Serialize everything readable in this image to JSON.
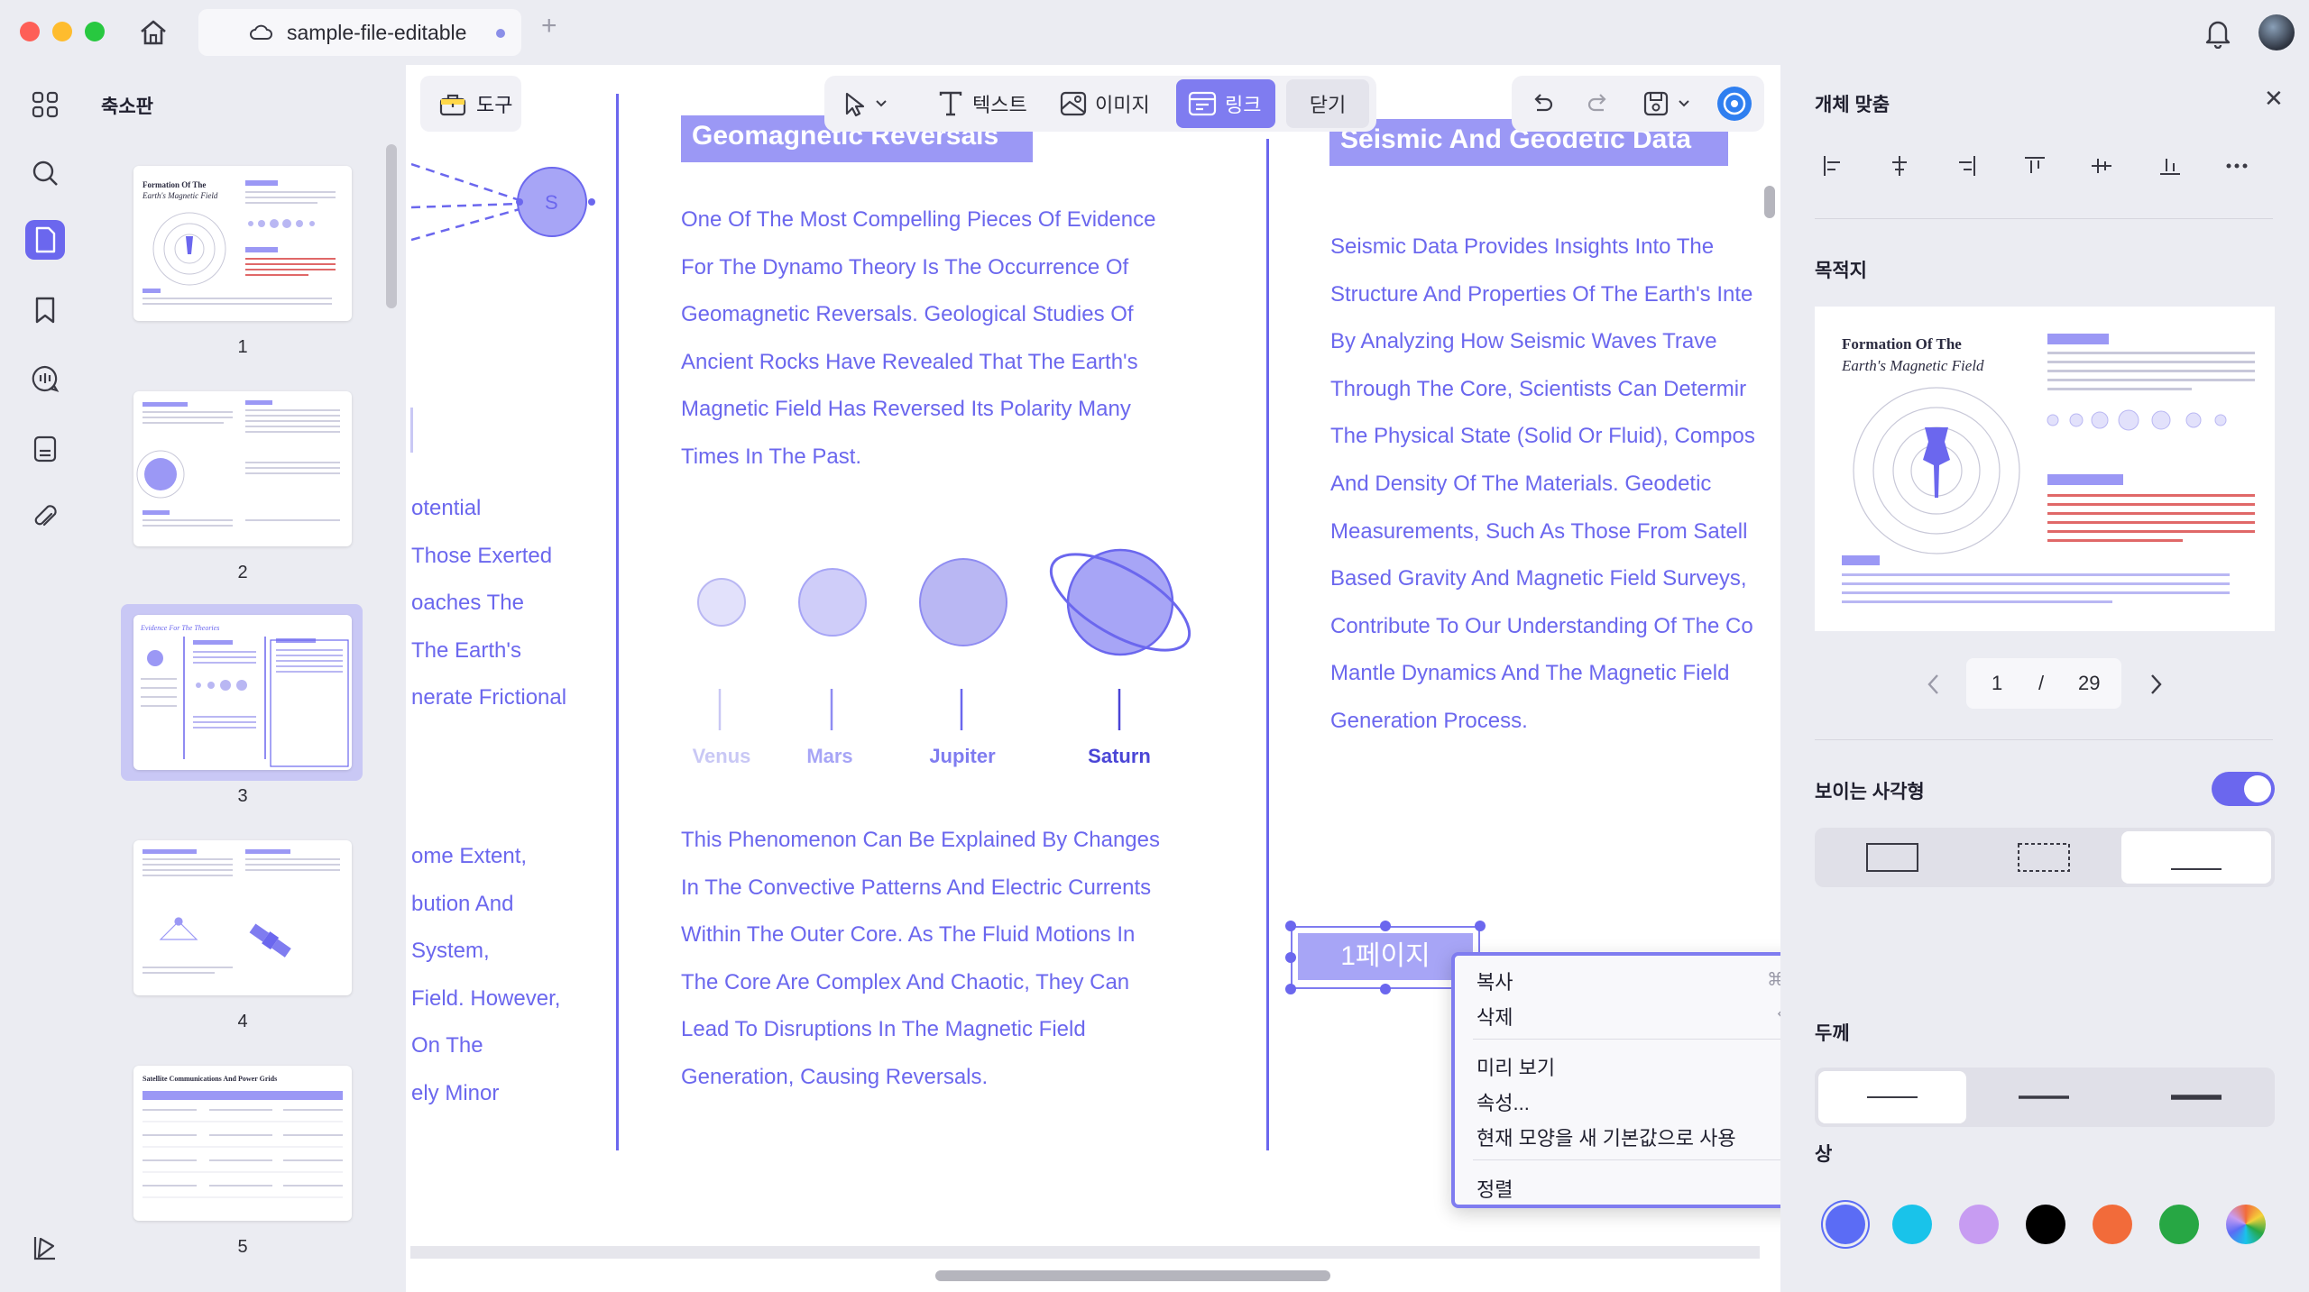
{
  "window": {
    "tab_title": "sample-file-editable",
    "tab_add": "+"
  },
  "thumbnails": {
    "title": "축소판",
    "pages": [
      {
        "num": "1",
        "heading": "Formation Of The",
        "subheading": "Earth's Magnetic Field"
      },
      {
        "num": "2"
      },
      {
        "num": "3",
        "heading": "Evidence For The Theories"
      },
      {
        "num": "4"
      },
      {
        "num": "5",
        "heading": "Satellite Communications And Power Grids"
      }
    ]
  },
  "toolbar": {
    "tools_label": "도구",
    "text_label": "텍스트",
    "image_label": "이미지",
    "link_label": "링크",
    "close_label": "닫기"
  },
  "document": {
    "left_fragments": [
      "otential",
      "Those Exerted",
      "oaches The",
      "The Earth's",
      "nerate Frictional",
      "ome Extent,",
      "bution And",
      "System,",
      "Field. However,",
      "On The",
      "ely Minor"
    ],
    "geomagnetic_heading": "Geomagnetic Reversals",
    "geomagnetic_paragraph": [
      "One Of The Most Compelling Pieces Of Evidence",
      "For The Dynamo Theory Is The Occurrence Of",
      "Geomagnetic Reversals. Geological Studies Of",
      "Ancient Rocks Have Revealed That The Earth's",
      "Magnetic Field Has Reversed Its Polarity Many",
      "Times In The Past."
    ],
    "planets": [
      "Venus",
      "Mars",
      "Jupiter",
      "Saturn"
    ],
    "phenomenon_paragraph": [
      "This Phenomenon Can Be Explained By Changes",
      "In The Convective Patterns And Electric Currents",
      "Within The Outer Core. As The Fluid Motions In",
      "The Core Are Complex And Chaotic, They Can",
      "Lead To Disruptions In The Magnetic Field",
      "Generation, Causing Reversals."
    ],
    "seismic_heading": "Seismic And Geodetic Data",
    "seismic_paragraph": [
      "Seismic Data Provides Insights Into The",
      "Structure And Properties Of The Earth's Inte",
      "By Analyzing How Seismic Waves Trave",
      "Through The Core, Scientists Can Determir",
      "The Physical State (Solid Or Fluid), Compos",
      "And Density Of The Materials. Geodetic",
      "Measurements, Such As Those From Satell",
      "Based Gravity And Magnetic Field Surveys,",
      "Contribute To Our Understanding Of The Co",
      "Mantle Dynamics And The Magnetic Field",
      "Generation Process."
    ],
    "link_box_label": "1페이지"
  },
  "context_menu": {
    "copy": "복사",
    "copy_shortcut": "⌘ C",
    "delete": "삭제",
    "delete_shortcut": "⌫",
    "preview": "미리 보기",
    "properties": "속성...",
    "set_default": "현재 모양을 새 기본값으로 사용",
    "arrange": "정렬",
    "arrange_arrow": "›"
  },
  "right_panel": {
    "align_title": "개체 맞춤",
    "destination_title": "목적지",
    "preview_heading": "Formation Of The",
    "preview_subheading": "Earth's Magnetic Field",
    "current_page": "1",
    "page_separator": "/",
    "total_pages": "29",
    "visible_rect_label": "보이는 사각형",
    "visible_rect_on": true,
    "thickness_label": "두께",
    "color_label": "상",
    "colors": [
      "#5b6cf5",
      "#19c3ea",
      "#c79cf2",
      "#000000",
      "#f26b3a",
      "#27a744"
    ]
  },
  "colors": {
    "accent": "#6b67ee",
    "heading_bg": "#9b98f5",
    "panel_bg": "#ebecf2"
  }
}
